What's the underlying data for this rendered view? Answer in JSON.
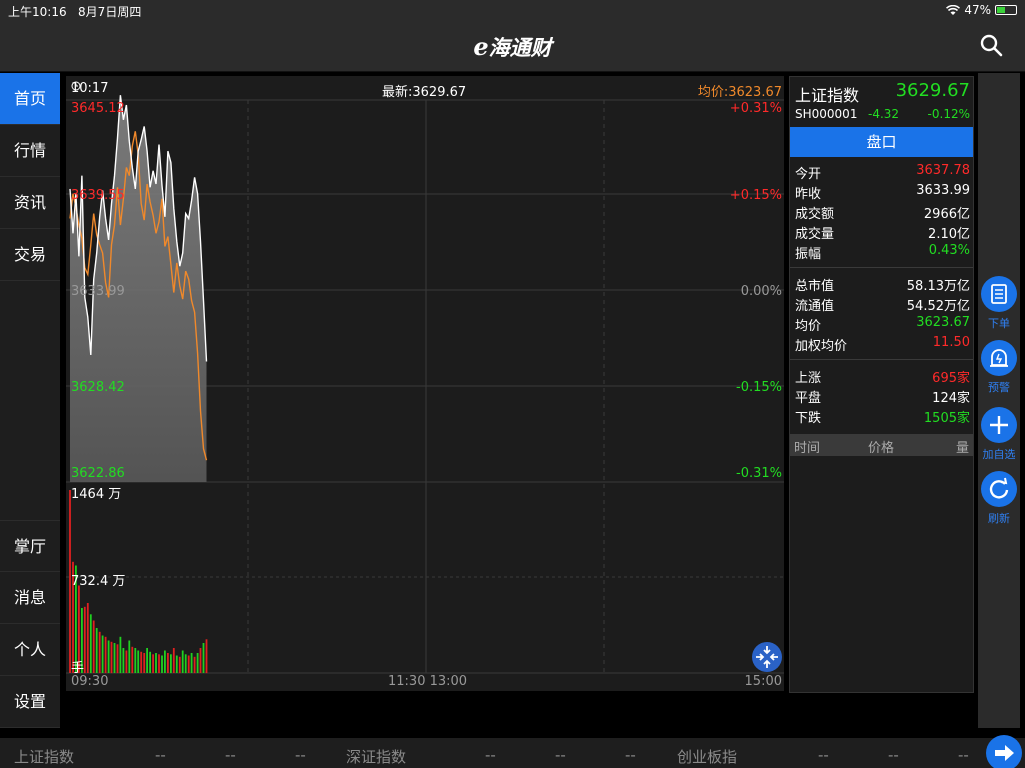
{
  "status_bar": {
    "time": "上午10:16",
    "date": "8月7日周四",
    "battery": "47%",
    "battery_level": 0.47
  },
  "header": {
    "logo_e": "e",
    "logo_text": "海通财",
    "search_icon": "search-icon"
  },
  "nav": {
    "items": [
      {
        "label": "首页",
        "active": true
      },
      {
        "label": "行情",
        "active": false
      },
      {
        "label": "资讯",
        "active": false
      },
      {
        "label": "交易",
        "active": false
      },
      {
        "label": "掌厅",
        "active": false
      },
      {
        "label": "消息",
        "active": false
      },
      {
        "label": "个人",
        "active": false
      },
      {
        "label": "设置",
        "active": false
      }
    ]
  },
  "chart_header": {
    "time": "10:17",
    "latest": "最新:3629.67",
    "avg": "均价:3623.67"
  },
  "chart_data": [
    {
      "type": "line",
      "title": "",
      "x_times_minutes": [
        0,
        1,
        2,
        3,
        4,
        5,
        6,
        7,
        8,
        9,
        10,
        11,
        12,
        13,
        14,
        15,
        16,
        17,
        18,
        19,
        20,
        21,
        22,
        23,
        24,
        25,
        26,
        27,
        28,
        29,
        30,
        31,
        32,
        33,
        34,
        35,
        36,
        37,
        38,
        39,
        40,
        41,
        42,
        43,
        44,
        45,
        46
      ],
      "series": [
        {
          "name": "最新",
          "color": "#ffffff",
          "values": [
            3640.2,
            3637.5,
            3639.9,
            3636.1,
            3641.0,
            3633.6,
            3632.4,
            3630.1,
            3634.7,
            3636.3,
            3638.5,
            3640.1,
            3638.4,
            3637.1,
            3639.3,
            3641.0,
            3643.3,
            3645.9,
            3644.4,
            3645.3,
            3643.1,
            3641.5,
            3640.2,
            3642.5,
            3643.2,
            3644.0,
            3642.5,
            3640.3,
            3641.3,
            3640.5,
            3642.9,
            3640.4,
            3638.5,
            3642.5,
            3641.8,
            3639.0,
            3637.0,
            3635.5,
            3636.3,
            3638.7,
            3638.4,
            3639.5,
            3640.9,
            3639.9,
            3637.0,
            3633.4,
            3629.7
          ]
        },
        {
          "name": "均价",
          "color": "#f0892b",
          "values": [
            3638.4,
            3639.9,
            3639.1,
            3638.0,
            3637.2,
            3635.4,
            3635.0,
            3636.8,
            3638.7,
            3637.4,
            3636.8,
            3636.3,
            3634.5,
            3633.6,
            3636.8,
            3638.0,
            3640.3,
            3638.0,
            3639.6,
            3641.5,
            3641.0,
            3642.8,
            3643.7,
            3642.3,
            3639.3,
            3638.3,
            3640.5,
            3639.4,
            3638.6,
            3637.5,
            3638.2,
            3639.6,
            3636.7,
            3637.3,
            3635.6,
            3633.9,
            3635.7,
            3634.3,
            3633.5,
            3635.2,
            3634.7,
            3633.4,
            3632.7,
            3630.2,
            3626.7,
            3624.4,
            3623.7
          ]
        }
      ],
      "y_axis_labels_left": [
        "3645.12",
        "3639.55",
        "3633.99",
        "3628.42",
        "3622.86"
      ],
      "y_axis_labels_right": [
        "+0.31%",
        "+0.15%",
        "0.00%",
        "-0.15%",
        "-0.31%"
      ],
      "ylim": [
        3622.86,
        3645.12
      ],
      "x_tick_labels": [
        "09:30",
        "11:30 13:00",
        "15:00"
      ],
      "grid": true
    },
    {
      "type": "bar",
      "title": "",
      "y_axis_labels": [
        "1464 万",
        "732.4 万",
        "手"
      ],
      "ylim": [
        0,
        1464
      ],
      "values": [
        1464,
        890,
        860,
        700,
        520,
        530,
        560,
        470,
        420,
        360,
        330,
        300,
        290,
        260,
        250,
        240,
        230,
        290,
        200,
        180,
        260,
        210,
        200,
        180,
        170,
        160,
        200,
        170,
        150,
        160,
        150,
        140,
        180,
        160,
        150,
        200,
        140,
        130,
        180,
        150,
        140,
        160,
        130,
        160,
        200,
        240,
        270
      ],
      "up": [
        1,
        1,
        0,
        1,
        0,
        1,
        1,
        0,
        1,
        0,
        1,
        0,
        1,
        0,
        1,
        0,
        1,
        0,
        0,
        1,
        0,
        1,
        0,
        0,
        1,
        1,
        0,
        0,
        1,
        0,
        1,
        0,
        0,
        1,
        0,
        1,
        0,
        1,
        0,
        0,
        1,
        0,
        1,
        0,
        1,
        0,
        1
      ]
    }
  ],
  "quote": {
    "name": "上证指数",
    "price": "3629.67",
    "code": "SH000001",
    "change": "-4.32",
    "change_pct": "-0.12%",
    "pankou_label": "盘口",
    "group1": [
      {
        "k": "今开",
        "v": "3637.78",
        "color": "red"
      },
      {
        "k": "昨收",
        "v": "3633.99",
        "color": "white"
      },
      {
        "k": "成交额",
        "v": "2966亿",
        "color": "white"
      },
      {
        "k": "成交量",
        "v": "2.10亿",
        "color": "white"
      },
      {
        "k": "振幅",
        "v": "0.43%",
        "color": "green"
      }
    ],
    "group2": [
      {
        "k": "总市值",
        "v": "58.13万亿",
        "color": "white"
      },
      {
        "k": "流通值",
        "v": "54.52万亿",
        "color": "white"
      },
      {
        "k": "均价",
        "v": "3623.67",
        "color": "green"
      },
      {
        "k": "加权均价",
        "v": "11.50",
        "color": "red"
      }
    ],
    "group3": [
      {
        "k": "上涨",
        "v": "695家",
        "color": "red"
      },
      {
        "k": "平盘",
        "v": "124家",
        "color": "white"
      },
      {
        "k": "下跌",
        "v": "1505家",
        "color": "green"
      }
    ],
    "ticks_head": {
      "time": "时间",
      "price": "价格",
      "vol": "量"
    }
  },
  "actions": [
    {
      "label": "下单",
      "icon": "order-icon"
    },
    {
      "label": "预警",
      "icon": "alarm-icon"
    },
    {
      "label": "加自选",
      "icon": "plus-icon"
    },
    {
      "label": "刷新",
      "icon": "refresh-icon"
    }
  ],
  "ticker": {
    "i1": "上证指数",
    "i1a": "--",
    "i1b": "--",
    "i1c": "--",
    "i2": "深证指数",
    "i2a": "--",
    "i2b": "--",
    "i2c": "--",
    "i3": "创业板指",
    "i3a": "--",
    "i3b": "--",
    "i3c": "--"
  }
}
